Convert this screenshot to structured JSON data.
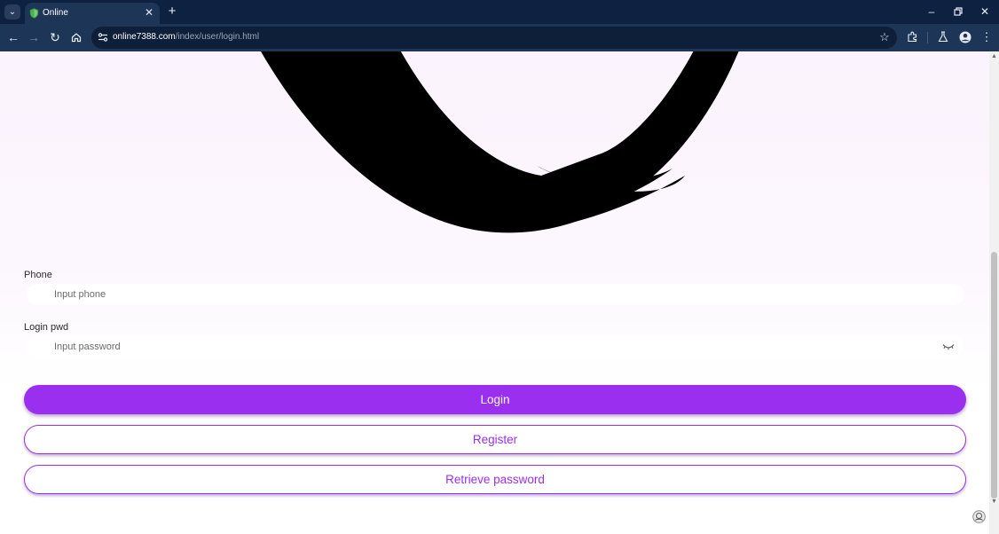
{
  "browser": {
    "tab_title": "Online",
    "url_host": "online7388.com",
    "url_path": "/index/user/login.html"
  },
  "form": {
    "phone_label": "Phone",
    "phone_placeholder": "Input phone",
    "password_label": "Login pwd",
    "password_placeholder": "Input password"
  },
  "buttons": {
    "login": "Login",
    "register": "Register",
    "retrieve": "Retrieve password"
  },
  "colors": {
    "accent": "#9a2ff0",
    "chrome_bg": "#0f2140",
    "toolbar_bg": "#1d3557",
    "page_bg_top": "#fbf3fd"
  },
  "icons": {
    "tab_favicon": "shield-icon",
    "password_toggle": "eye-closed-icon",
    "floating_widget": "support-icon"
  }
}
